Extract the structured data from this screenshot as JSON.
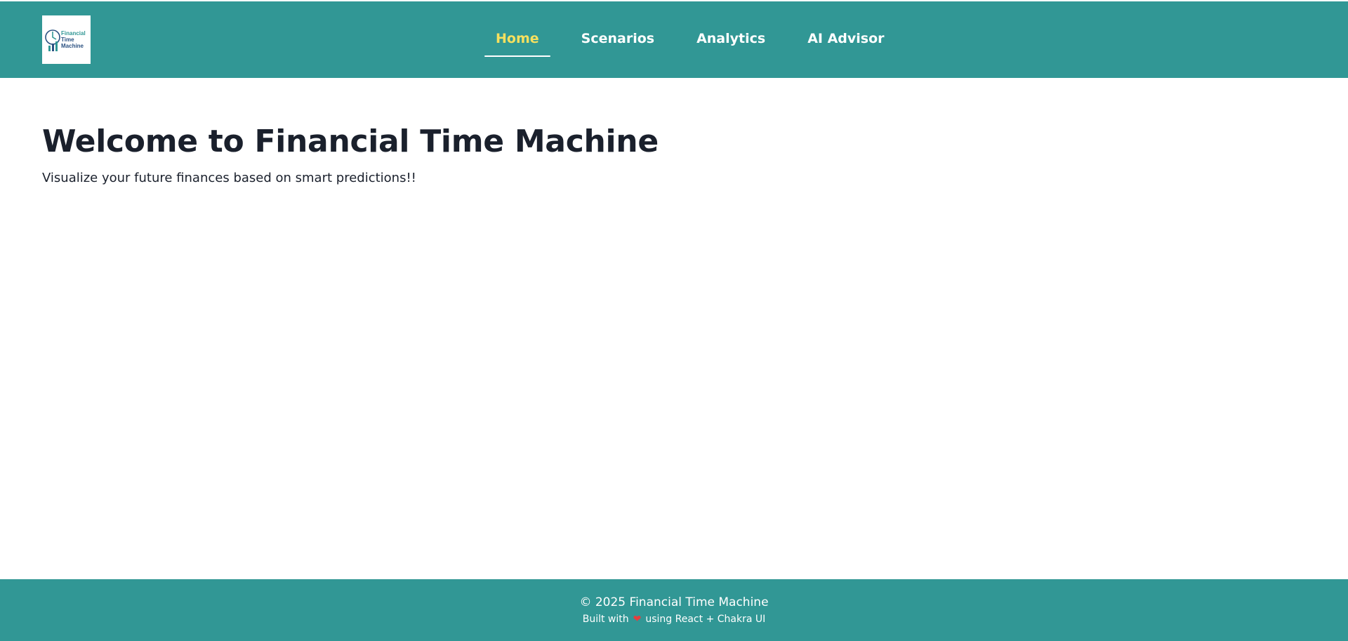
{
  "header": {
    "logo_text": [
      "Financial",
      "Time",
      "Machine"
    ],
    "nav": [
      {
        "label": "Home",
        "active": true
      },
      {
        "label": "Scenarios",
        "active": false
      },
      {
        "label": "Analytics",
        "active": false
      },
      {
        "label": "AI Advisor",
        "active": false
      }
    ]
  },
  "main": {
    "title": "Welcome to Financial Time Machine",
    "subtitle": "Visualize your future finances based on smart predictions!!"
  },
  "footer": {
    "copyright": "© 2025 Financial Time Machine",
    "built_prefix": "Built with",
    "heart_icon": "heart-icon",
    "built_suffix": "using React + Chakra UI"
  },
  "colors": {
    "brand_teal": "#319795",
    "active_nav": "#f6e05e",
    "text_dark": "#1a202c",
    "heart": "#e53e3e"
  }
}
